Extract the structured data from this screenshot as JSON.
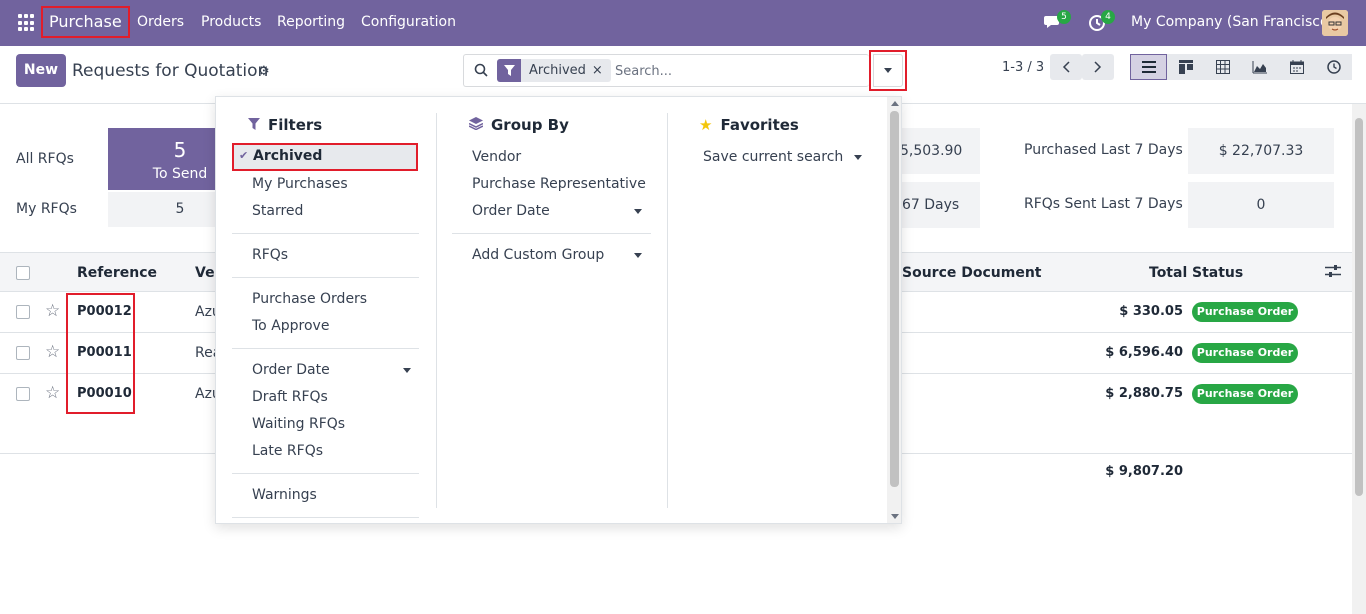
{
  "navbar": {
    "app_name": "Purchase",
    "menu": [
      "Orders",
      "Products",
      "Reporting",
      "Configuration"
    ],
    "chat_count": "5",
    "activity_count": "4",
    "company": "My Company (San Francisco)"
  },
  "control": {
    "new_label": "New",
    "title": "Requests for Quotation",
    "search_facet": "Archived",
    "search_remove": "×",
    "search_placeholder": "Search...",
    "pager": "1-3 / 3"
  },
  "dashboard": {
    "all_rfqs_label": "All RFQs",
    "my_rfqs_label": "My RFQs",
    "to_send_count": "5",
    "to_send_label": "To Send",
    "my_to_send": "5",
    "hidden_value_1": "5,503.90",
    "hidden_value_2": "67 Days",
    "purchased_label": "Purchased Last 7 Days",
    "purchased_value": "$ 22,707.33",
    "rfqs_sent_label": "RFQs Sent Last 7 Days",
    "rfqs_sent_value": "0"
  },
  "table": {
    "headers": {
      "reference": "Reference",
      "vendor": "Ver",
      "source": "Source Document",
      "total": "Total",
      "status": "Status"
    },
    "rows": [
      {
        "ref": "P00012",
        "vendor": "Azu",
        "total": "$ 330.05",
        "status": "Purchase Order"
      },
      {
        "ref": "P00011",
        "vendor": "Rea",
        "total": "$ 6,596.40",
        "status": "Purchase Order"
      },
      {
        "ref": "P00010",
        "vendor": "Azu",
        "total": "$ 2,880.75",
        "status": "Purchase Order"
      }
    ],
    "grand_total": "$ 9,807.20"
  },
  "dropdown": {
    "filters_title": "Filters",
    "group_by_title": "Group By",
    "favorites_title": "Favorites",
    "filters": {
      "archived": "Archived",
      "my_purchases": "My Purchases",
      "starred": "Starred",
      "rfqs": "RFQs",
      "purchase_orders": "Purchase Orders",
      "to_approve": "To Approve",
      "order_date": "Order Date",
      "draft_rfqs": "Draft RFQs",
      "waiting_rfqs": "Waiting RFQs",
      "late_rfqs": "Late RFQs",
      "warnings": "Warnings"
    },
    "group_by": {
      "vendor": "Vendor",
      "purchase_rep": "Purchase Representative",
      "order_date": "Order Date",
      "custom_group": "Add Custom Group"
    },
    "favorites": {
      "save_search": "Save current search"
    }
  }
}
